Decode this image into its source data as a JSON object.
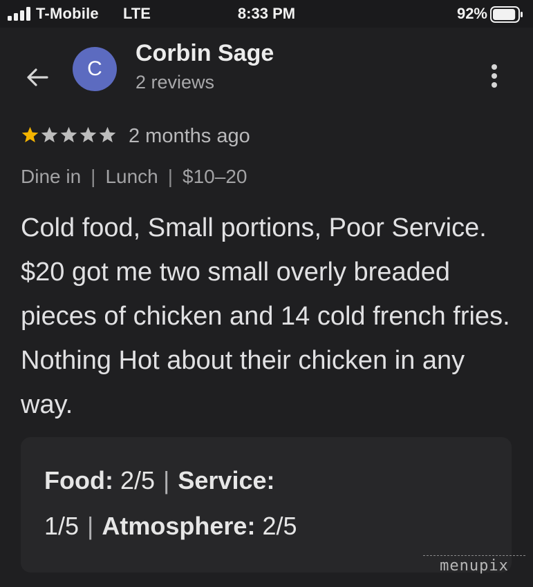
{
  "status_bar": {
    "carrier": "T-Mobile",
    "network": "LTE",
    "time": "8:33 PM",
    "battery_percent": "92%",
    "battery_level": 0.92,
    "signal_bars": 4,
    "icons": [
      "signal-bars-icon",
      "battery-icon"
    ]
  },
  "header": {
    "back_icon": "back-arrow-icon",
    "avatar_initial": "C",
    "avatar_color": "#5c6bc0",
    "reviewer_name": "Corbin Sage",
    "review_count": "2 reviews",
    "menu_icon": "more-vertical-icon"
  },
  "review": {
    "rating": 1,
    "max_rating": 5,
    "star_color_filled": "#f4b400",
    "star_color_empty": "#bdbdbd",
    "time_ago": "2 months ago",
    "meta": [
      "Dine in",
      "Lunch",
      "$10–20"
    ],
    "text": "Cold food, Small portions, Poor Service. $20 got me two small overly breaded pieces of chicken and 14 cold french fries. Nothing Hot about their chicken in any way."
  },
  "ratings_card": {
    "food_label": "Food:",
    "food_value": "2/5",
    "service_label": "Service:",
    "service_value": "1/5",
    "atmosphere_label": "Atmosphere:",
    "atmosphere_value": "2/5"
  },
  "watermark": "menupix"
}
